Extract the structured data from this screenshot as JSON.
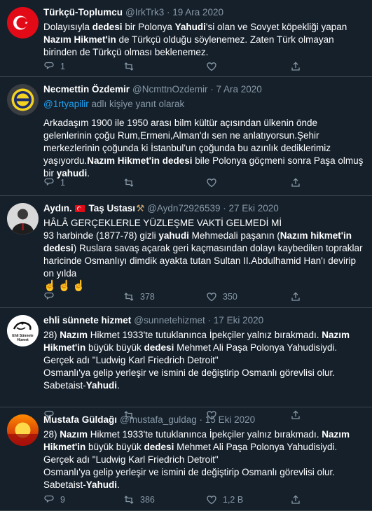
{
  "colors": {
    "background": "#15202b",
    "divider": "#38444d",
    "muted": "#8899a6",
    "link": "#1da1f2"
  },
  "tweets": [
    {
      "name": "Türkçü-Toplumcu",
      "handle": "@IrkTrk3",
      "date": "19 Ara 2020",
      "avatar": "turkish-flag",
      "lines": [
        [
          {
            "t": "Dolayısıyla "
          },
          {
            "t": "dedesi",
            "b": true
          },
          {
            "t": " bir Polonya "
          },
          {
            "t": "Yahudi",
            "b": true
          },
          {
            "t": "'si olan ve Sovyet köpekliği yapan"
          }
        ],
        [
          {
            "t": "Nazım Hikmet'in",
            "b": true
          },
          {
            "t": " de Türkçü olduğu söylenemez. Zaten Türk  olmayan"
          }
        ],
        [
          {
            "t": "birinden de Türkçü olması beklenemez."
          }
        ]
      ],
      "replies": "1",
      "retweets": "",
      "likes": ""
    },
    {
      "name": "Necmettin Özdemir",
      "handle": "@NcmttnOzdemir",
      "date": "7 Ara 2020",
      "avatar": "team-badge",
      "replying_link": "@1rtyapilir",
      "replying_rest": " adlı kişiye yanıt olarak",
      "lines": [
        [
          {
            "t": "Arkadaşım 1900 ile 1950 arası bilm kültür açısından ülkenin önde"
          }
        ],
        [
          {
            "t": "gelenlerinin çoğu Rum,Ermeni,Alman'dı sen ne anlatıyorsun.Şehir"
          }
        ],
        [
          {
            "t": "merkezlerinin çoğunda ki İstanbul'un çoğunda bu azınlık dediklerimiz"
          }
        ],
        [
          {
            "t": "yaşıyordu."
          },
          {
            "t": "Nazım Hikmet'in dedesi",
            "b": true
          },
          {
            "t": " bile Polonya göçmeni sonra Paşa olmuş"
          }
        ],
        [
          {
            "t": "bir "
          },
          {
            "t": "yahudi",
            "b": true
          },
          {
            "t": "."
          }
        ]
      ],
      "replies": "1",
      "retweets": "",
      "likes": ""
    },
    {
      "name": "Aydın.",
      "name_suffix": " Taş Ustası",
      "handle": "@Aydn72926539",
      "date": "27 Eki 2020",
      "avatar": "portrait",
      "lines": [
        [
          {
            "t": "HÂLÂ GERÇEKLERLE YÜZLEŞME VAKTİ GELMEDİ Mİ"
          }
        ],
        [
          {
            "t": "93 harbinde (1877-78) gizli "
          },
          {
            "t": "yahudi",
            "b": true
          },
          {
            "t": " Mehmedali paşanın ("
          },
          {
            "t": "Nazım hikmet'in",
            "b": true
          }
        ],
        [
          {
            "t": "dedesi",
            "b": true
          },
          {
            "t": ") Ruslara savaş açarak geri kaçmasından dolayı kaybedilen topraklar"
          }
        ],
        [
          {
            "t": "haricinde Osmanlıyı dimdik ayakta tutan Sultan II.Abdulhamid Han'ı devirip"
          }
        ],
        [
          {
            "t": "on yılda"
          }
        ]
      ],
      "emoji": "☝☝☝",
      "replies": "",
      "retweets": "378",
      "likes": "350"
    },
    {
      "name": "ehli sünnete hizmet",
      "handle": "@sunnetehizmet",
      "date": "17 Eki 2020",
      "avatar": "calligraphy-logo",
      "avatar_text": "Ehli Sünnete Hizmet",
      "lines": [
        [
          {
            "t": "28) "
          },
          {
            "t": "Nazım",
            "b": true
          },
          {
            "t": " Hikmet 1933'te tutuklanınca İpekçiler yalnız bırakmadı. "
          },
          {
            "t": "Nazım",
            "b": true
          }
        ],
        [
          {
            "t": "Hikmet'in",
            "b": true
          },
          {
            "t": " büyük büyük "
          },
          {
            "t": "dedesi",
            "b": true
          },
          {
            "t": " Mehmet Ali Paşa Polonya Yahudisiydi."
          }
        ],
        [
          {
            "t": "Gerçek adı \"Ludwig Karl Friedrich Detroit\""
          }
        ],
        [
          {
            "t": "Osmanlı'ya gelip yerleşir ve ismini de değiştirip Osmanlı görevlisi olur."
          }
        ],
        [
          {
            "t": "Sabetaist-"
          },
          {
            "t": "Yahudi",
            "b": true
          },
          {
            "t": "."
          }
        ]
      ],
      "replies": "",
      "retweets": "",
      "likes": ""
    },
    {
      "name": "Mustafa Güldağı",
      "handle": "@mustafa_guldag",
      "date": "15 Eki 2020",
      "avatar": "sunset",
      "lines": [
        [
          {
            "t": "28) "
          },
          {
            "t": "Nazım",
            "b": true
          },
          {
            "t": " Hikmet 1933'te tutuklanınca İpekçiler yalnız bırakmadı. "
          },
          {
            "t": "Nazım",
            "b": true
          }
        ],
        [
          {
            "t": "Hikmet'in",
            "b": true
          },
          {
            "t": " büyük büyük "
          },
          {
            "t": "dedesi",
            "b": true
          },
          {
            "t": " Mehmet Ali Paşa Polonya Yahudisiydi."
          }
        ],
        [
          {
            "t": "Gerçek adı \"Ludwig Karl Friedrich Detroit\""
          }
        ],
        [
          {
            "t": "Osmanlı'ya gelip yerleşir ve ismini de değiştirip Osmanlı görevlisi olur."
          }
        ],
        [
          {
            "t": "Sabetaist-"
          },
          {
            "t": "Yahudi",
            "b": true
          },
          {
            "t": "."
          }
        ]
      ],
      "replies": "9",
      "retweets": "386",
      "likes": "1,2 B"
    }
  ]
}
